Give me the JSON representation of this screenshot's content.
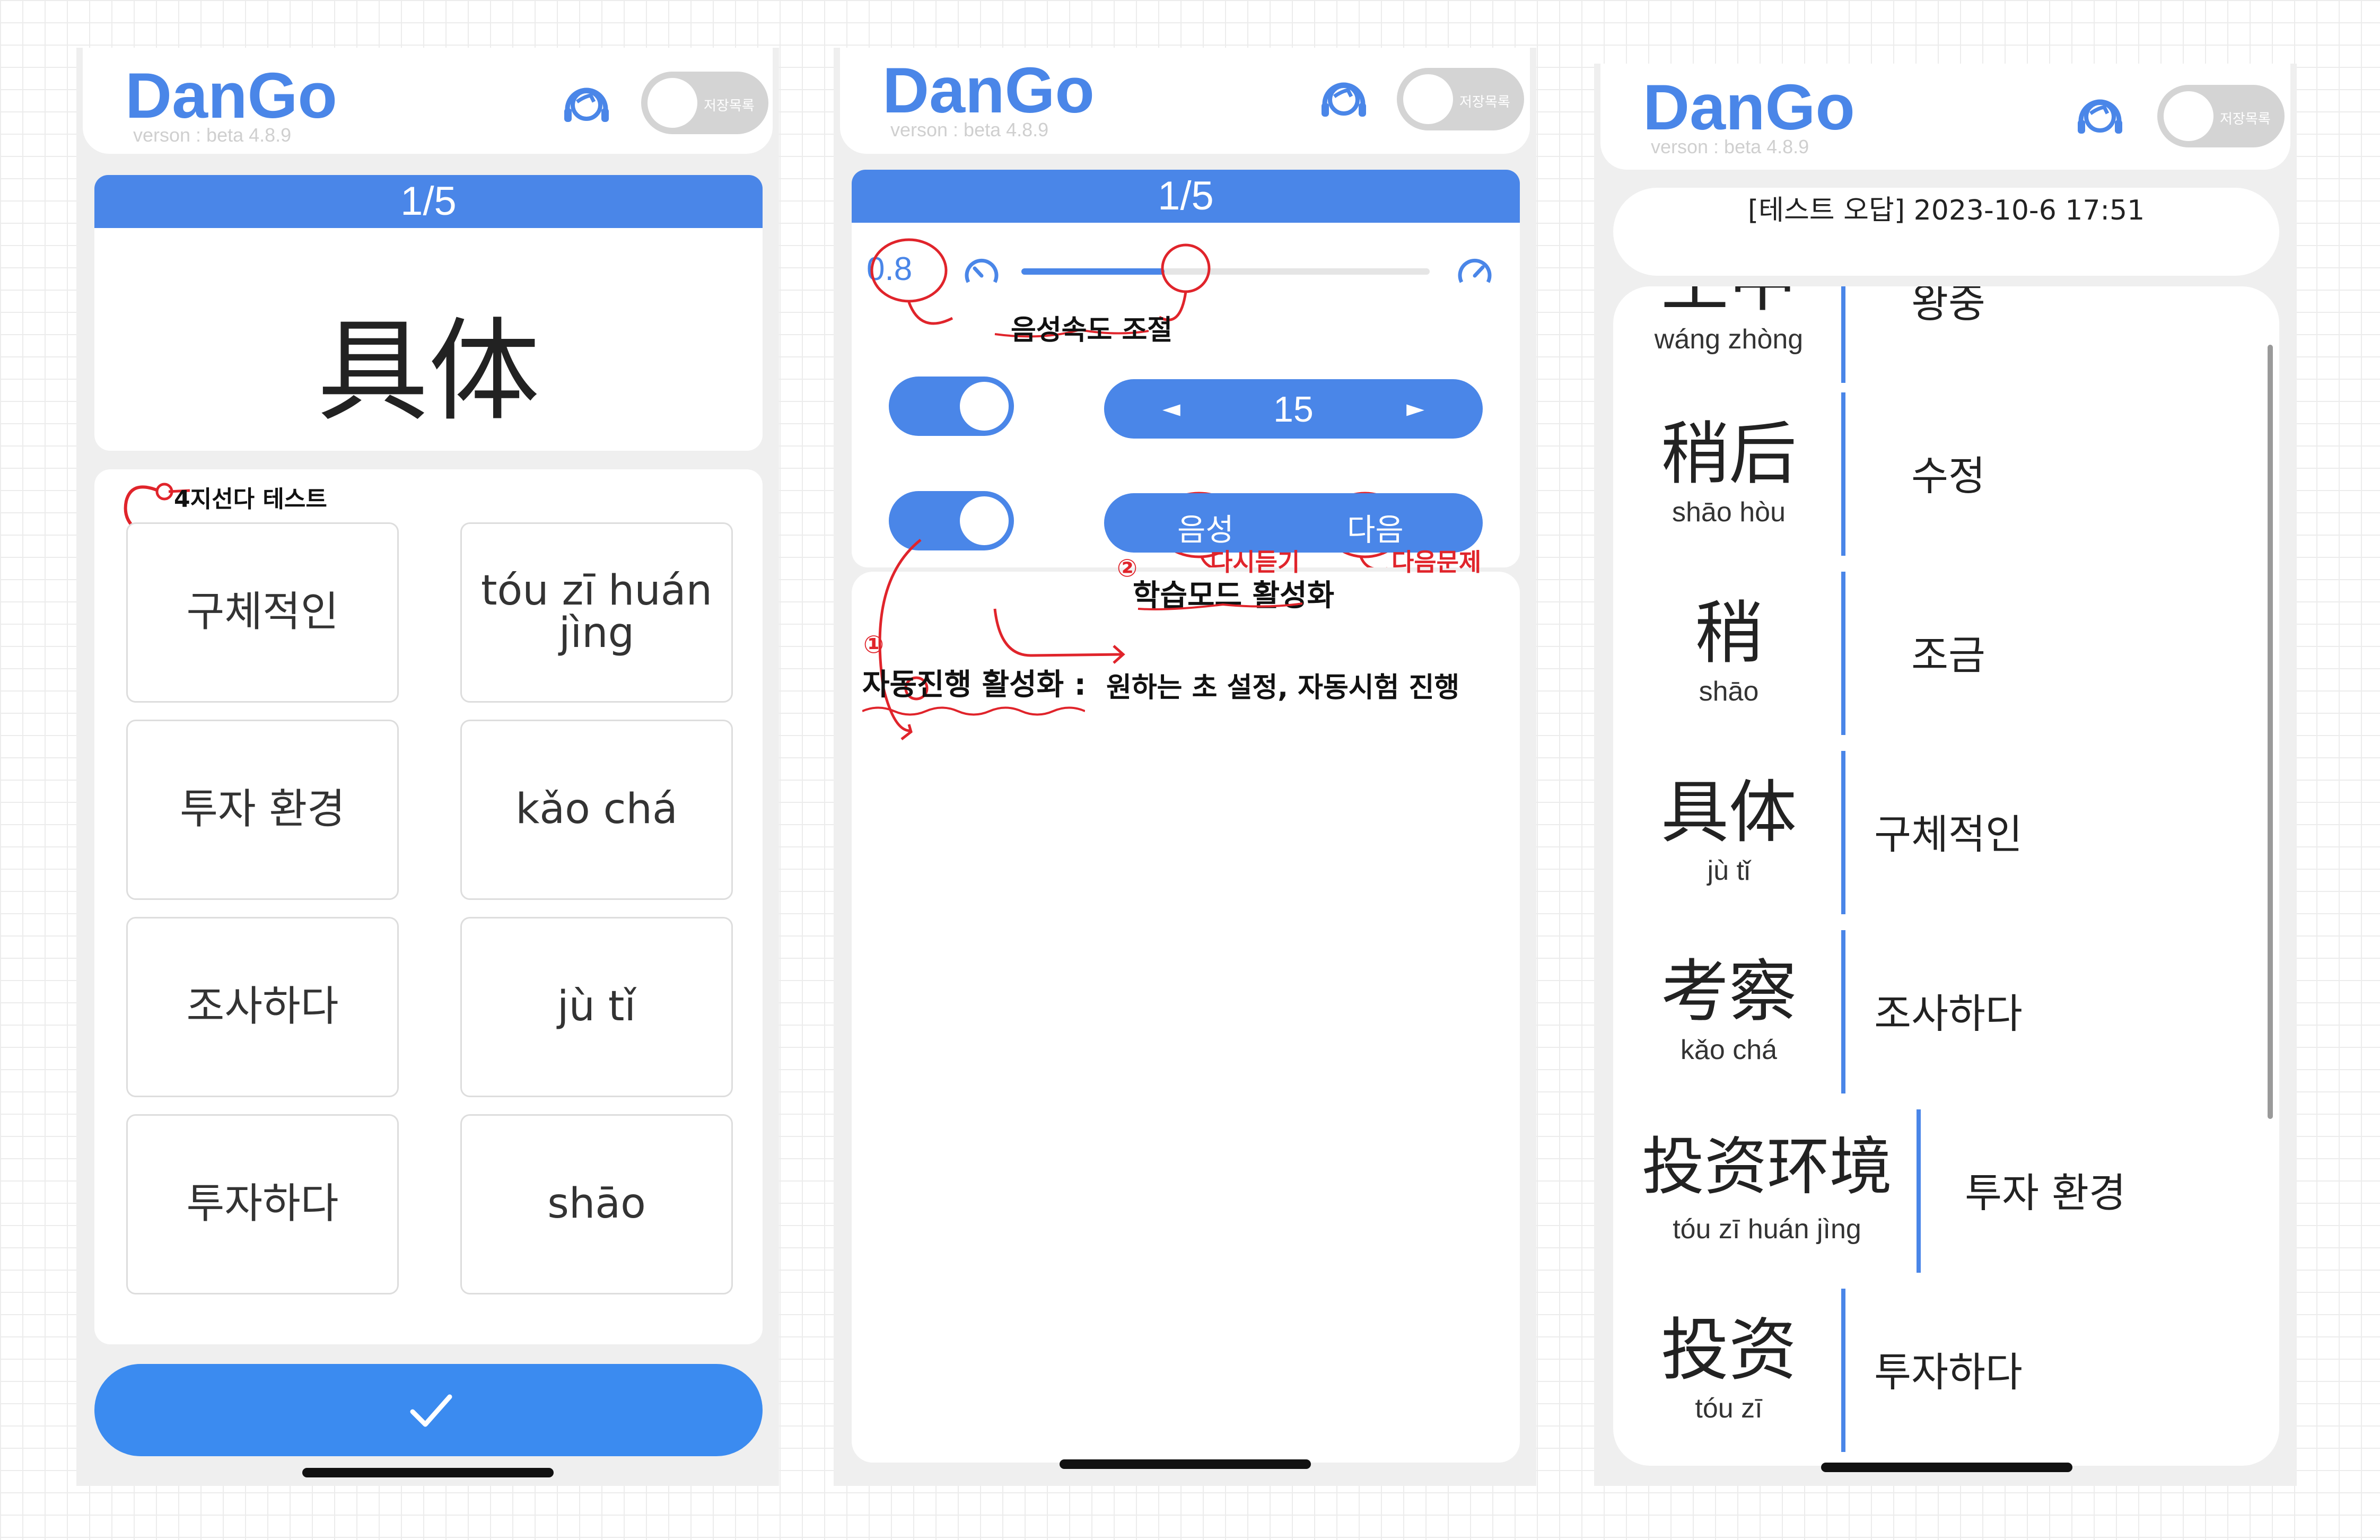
{
  "app": {
    "name": "DanGo",
    "version": "verson : beta 4.8.9",
    "toggle_label": "저장목록"
  },
  "screen1": {
    "progress": "1/5",
    "word": "具体",
    "annotation": "4지선다 테스트",
    "options": [
      "구체적인",
      "tóu zī huán jìng",
      "투자 환경",
      "kǎo chá",
      "조사하다",
      "jù tǐ",
      "투자하다",
      "shāo"
    ],
    "submit_icon": "check-icon"
  },
  "screen2": {
    "progress": "1/5",
    "speed_value": "0.8",
    "speed_level": 0.35,
    "speed_annotation": "음성속도 조절",
    "stepper": {
      "prev": "◄",
      "value": "15",
      "next": "►"
    },
    "buttons": {
      "voice": "음성",
      "next": "다음"
    },
    "notes": {
      "voice_note": "다시듣기",
      "next_note": "다음문제",
      "study_mode": "학습모드 활성화",
      "study_num": "②",
      "auto_num": "①",
      "auto_play": "자동진행 활성화 :",
      "auto_desc": "원하는 초 설정, 자동시험 진행"
    }
  },
  "screen3": {
    "result_title": "[테스트 오답] 2023-10-6 17:51",
    "cut_top": {
      "hanzi": "王中",
      "pinyin": "wáng zhòng",
      "meaning": "왕중"
    },
    "rows": [
      {
        "hanzi": "稍后",
        "pinyin": "shāo hòu",
        "meaning": "수정"
      },
      {
        "hanzi": "稍",
        "pinyin": "shāo",
        "meaning": "조금"
      },
      {
        "hanzi": "具体",
        "pinyin": "jù tǐ",
        "meaning": "구체적인"
      },
      {
        "hanzi": "考察",
        "pinyin": "kǎo chá",
        "meaning": "조사하다"
      },
      {
        "hanzi": "投资环境",
        "pinyin": "tóu zī huán jìng",
        "meaning": "투자 환경"
      },
      {
        "hanzi": "投资",
        "pinyin": "tóu zī",
        "meaning": "투자하다"
      }
    ]
  }
}
